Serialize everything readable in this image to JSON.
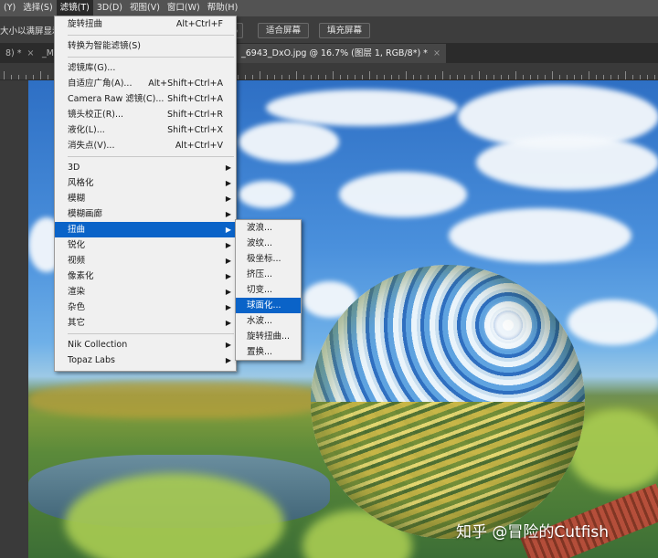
{
  "menubar": [
    "(Y)",
    "选择(S)",
    "滤镜(T)",
    "3D(D)",
    "视图(V)",
    "窗口(W)",
    "帮助(H)"
  ],
  "options": {
    "text": "大小以满屏显示",
    "zoom_fragment": "%",
    "fit_screen": "适合屏幕",
    "fill_screen": "填充屏幕"
  },
  "tabs": {
    "tab1": "8) *",
    "tab1_close": "×",
    "tab2": "_M",
    "tab3": "_6943_DxO.jpg @ 16.7% (图层 1, RGB/8*) *",
    "tab3_close": "×"
  },
  "filter_menu": {
    "last_filter": {
      "label": "旋转扭曲",
      "shortcut": "Alt+Ctrl+F"
    },
    "smart": {
      "label": "转换为智能滤镜(S)"
    },
    "gallery": {
      "label": "滤镜库(G)..."
    },
    "adaptive": {
      "label": "自适应广角(A)...",
      "shortcut": "Alt+Shift+Ctrl+A"
    },
    "camera_raw": {
      "label": "Camera Raw 滤镜(C)...",
      "shortcut": "Shift+Ctrl+A"
    },
    "lens": {
      "label": "镜头校正(R)...",
      "shortcut": "Shift+Ctrl+R"
    },
    "liquify": {
      "label": "液化(L)...",
      "shortcut": "Shift+Ctrl+X"
    },
    "vanishing": {
      "label": "消失点(V)...",
      "shortcut": "Alt+Ctrl+V"
    },
    "groups": [
      "3D",
      "风格化",
      "模糊",
      "模糊画廊",
      "扭曲",
      "锐化",
      "视频",
      "像素化",
      "渲染",
      "杂色",
      "其它"
    ],
    "plugins": [
      "Nik Collection",
      "Topaz Labs"
    ]
  },
  "distort_submenu": [
    "波浪...",
    "波纹...",
    "极坐标...",
    "挤压...",
    "切变...",
    "球面化...",
    "水波...",
    "旋转扭曲...",
    "置换..."
  ],
  "watermark": "知乎 @冒险的Cutfish",
  "colors": {
    "menu_highlight": "#0a63c8",
    "menubar_bg": "#535353"
  }
}
